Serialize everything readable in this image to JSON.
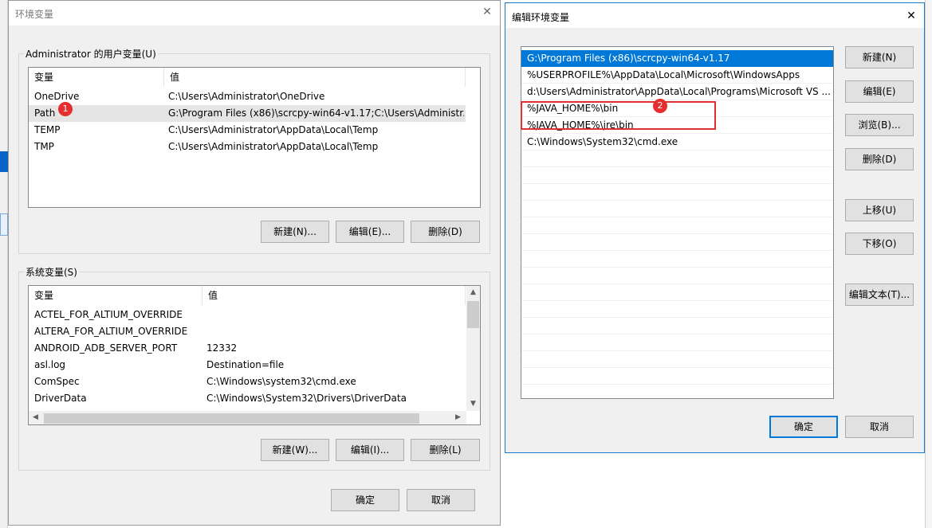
{
  "left_dialog": {
    "title": "环境变量",
    "user_vars": {
      "label": "Administrator 的用户变量(U)",
      "columns": [
        "变量",
        "值"
      ],
      "rows": [
        {
          "name": "OneDrive",
          "value": "C:\\Users\\Administrator\\OneDrive"
        },
        {
          "name": "Path",
          "value": "G:\\Program Files (x86)\\scrcpy-win64-v1.17;C:\\Users\\Administr..."
        },
        {
          "name": "TEMP",
          "value": "C:\\Users\\Administrator\\AppData\\Local\\Temp"
        },
        {
          "name": "TMP",
          "value": "C:\\Users\\Administrator\\AppData\\Local\\Temp"
        }
      ],
      "buttons": {
        "new": "新建(N)...",
        "edit": "编辑(E)...",
        "delete": "删除(D)"
      }
    },
    "system_vars": {
      "label": "系统变量(S)",
      "columns": [
        "变量",
        "值"
      ],
      "rows": [
        {
          "name": "ACTEL_FOR_ALTIUM_OVERRIDE",
          "value": ""
        },
        {
          "name": "ALTERA_FOR_ALTIUM_OVERRIDE",
          "value": ""
        },
        {
          "name": "ANDROID_ADB_SERVER_PORT",
          "value": "12332"
        },
        {
          "name": "asl.log",
          "value": "Destination=file"
        },
        {
          "name": "ComSpec",
          "value": "C:\\Windows\\system32\\cmd.exe"
        },
        {
          "name": "DriverData",
          "value": "C:\\Windows\\System32\\Drivers\\DriverData"
        }
      ],
      "buttons": {
        "new": "新建(W)...",
        "edit": "编辑(I)...",
        "delete": "删除(L)"
      }
    },
    "ok": "确定",
    "cancel": "取消"
  },
  "right_dialog": {
    "title": "编辑环境变量",
    "paths": [
      "G:\\Program Files (x86)\\scrcpy-win64-v1.17",
      "%USERPROFILE%\\AppData\\Local\\Microsoft\\WindowsApps",
      "d:\\Users\\Administrator\\AppData\\Local\\Programs\\Microsoft VS ...",
      "%JAVA_HOME%\\bin",
      "%JAVA_HOME%\\jre\\bin",
      "C:\\Windows\\System32\\cmd.exe"
    ],
    "buttons": {
      "new": "新建(N)",
      "edit": "编辑(E)",
      "browse": "浏览(B)...",
      "delete": "删除(D)",
      "move_up": "上移(U)",
      "move_down": "下移(O)",
      "edit_text": "编辑文本(T)..."
    },
    "ok": "确定",
    "cancel": "取消"
  },
  "annotations": {
    "badge1": "1",
    "badge2": "2"
  },
  "colors": {
    "selection": "#0078d7",
    "annotation_red": "#e03030"
  }
}
